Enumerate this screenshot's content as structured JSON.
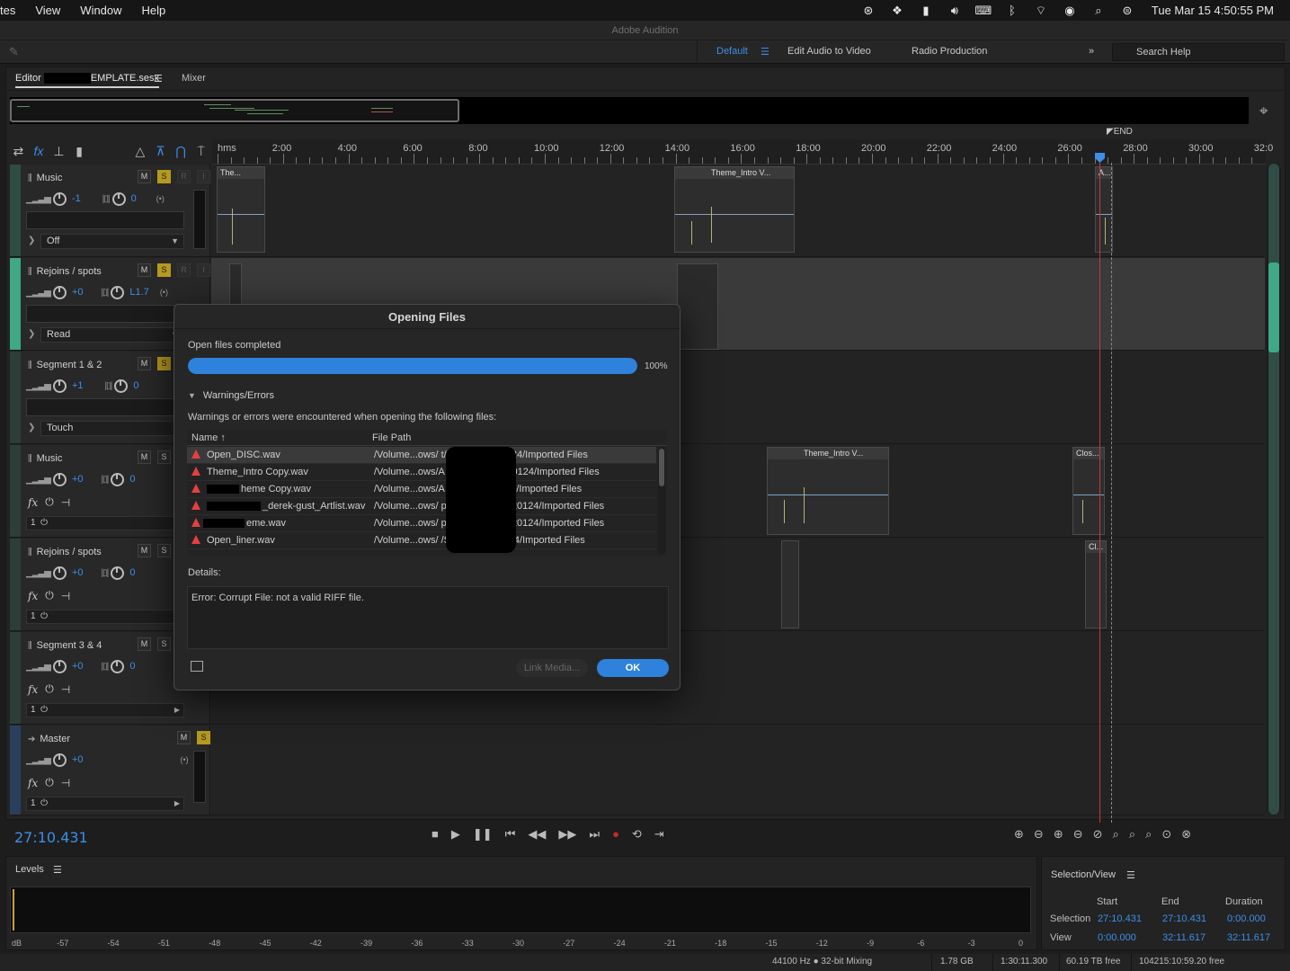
{
  "menubar": {
    "items": [
      "tes",
      "View",
      "Window",
      "Help"
    ],
    "clock": "Tue Mar 15  4:50:55 PM"
  },
  "app_title": "Adobe Audition",
  "workspaces": {
    "default": "Default",
    "edit_audio_video": "Edit Audio to Video",
    "radio": "Radio Production",
    "more": "»",
    "search_placeholder": "Search Help"
  },
  "tabs": {
    "editor_prefix": "Editor",
    "editor_file": "EMPLATE.sesx",
    "mixer": "Mixer"
  },
  "ruler": {
    "labels": [
      "hms",
      "2:00",
      "4:00",
      "6:00",
      "8:00",
      "10:00",
      "12:00",
      "14:00",
      "16:00",
      "18:00",
      "20:00",
      "22:00",
      "24:00",
      "26:00",
      "28:00",
      "30:00",
      "32:0"
    ],
    "end": "END"
  },
  "tracks": [
    {
      "name": "Music",
      "vol": "-1",
      "pan": "0",
      "mode": "Off",
      "solo": true
    },
    {
      "name": "Rejoins / spots",
      "vol": "+0",
      "pan": "L1.7",
      "mode": "Read",
      "solo": true
    },
    {
      "name": "Segment 1 & 2",
      "vol": "+1",
      "pan": "0",
      "mode": "Touch",
      "solo": true
    },
    {
      "name": "Music",
      "vol": "+0",
      "pan": "0",
      "slot": "1"
    },
    {
      "name": "Rejoins / spots",
      "vol": "+0",
      "pan": "0",
      "slot": "1"
    },
    {
      "name": "Segment 3 & 4",
      "vol": "+0",
      "pan": "0",
      "slot": "1"
    },
    {
      "name": "Master",
      "vol": "+0",
      "slot": "1"
    }
  ],
  "track_buttons": {
    "m": "M",
    "s": "S",
    "r": "R",
    "i": "I"
  },
  "clips": {
    "c1": "The...",
    "c2": "Theme_Intro V...",
    "c3": "A...",
    "c4": "Theme_Intro V...",
    "c5": "Clos...",
    "c6": "Cl..."
  },
  "timecode": "27:10.431",
  "levels": {
    "title": "Levels",
    "scale": [
      "dB",
      "-57",
      "-54",
      "-51",
      "-48",
      "-45",
      "-42",
      "-39",
      "-36",
      "-33",
      "-30",
      "-27",
      "-24",
      "-21",
      "-18",
      "-15",
      "-12",
      "-9",
      "-6",
      "-3",
      "0"
    ]
  },
  "selection_view": {
    "title": "Selection/View",
    "headers": {
      "start": "Start",
      "end": "End",
      "duration": "Duration"
    },
    "selection": {
      "label": "Selection",
      "start": "27:10.431",
      "end": "27:10.431",
      "duration": "0:00.000"
    },
    "view": {
      "label": "View",
      "start": "0:00.000",
      "end": "32:11.617",
      "duration": "32:11.617"
    }
  },
  "statusbar": {
    "format": "44100 Hz ● 32-bit Mixing",
    "mem": "1.78 GB",
    "dur": "1:30:11.300",
    "free": "60.19 TB free",
    "free_time": "104215:10:59.20 free"
  },
  "dialog": {
    "title": "Opening Files",
    "status": "Open files completed",
    "progress": 100,
    "percent_label": "100%",
    "section": "Warnings/Errors",
    "message": "Warnings or errors were encountered when opening the following files:",
    "col_name": "Name ↑",
    "col_path": "File Path",
    "rows": [
      {
        "name": "Open_DISC.wav",
        "path": "/Volume...ows/      t/Sessions/220124/Imported Files"
      },
      {
        "name": "Theme_Intro Copy.wav",
        "path": "/Volume...ows/A       nt/Sessions/220124/Imported Files"
      },
      {
        "name": "heme Copy.wav",
        "path": "/Volume...ows/A       essions/220124/Imported Files"
      },
      {
        "name": "_derek-gust_Artlist.wav",
        "path": "/Volume...ows/       print/Sessions/220124/Imported Files"
      },
      {
        "name": "eme.wav",
        "path": "/Volume...ows/       print/Sessions/220124/Imported Files"
      },
      {
        "name": "Open_liner.wav",
        "path": "/Volume...ows/       /Sessions/220124/Imported Files"
      }
    ],
    "details_label": "Details:",
    "details": "Error: Corrupt File: not a valid RIFF file.",
    "link_media": "Link Media...",
    "ok": "OK"
  }
}
